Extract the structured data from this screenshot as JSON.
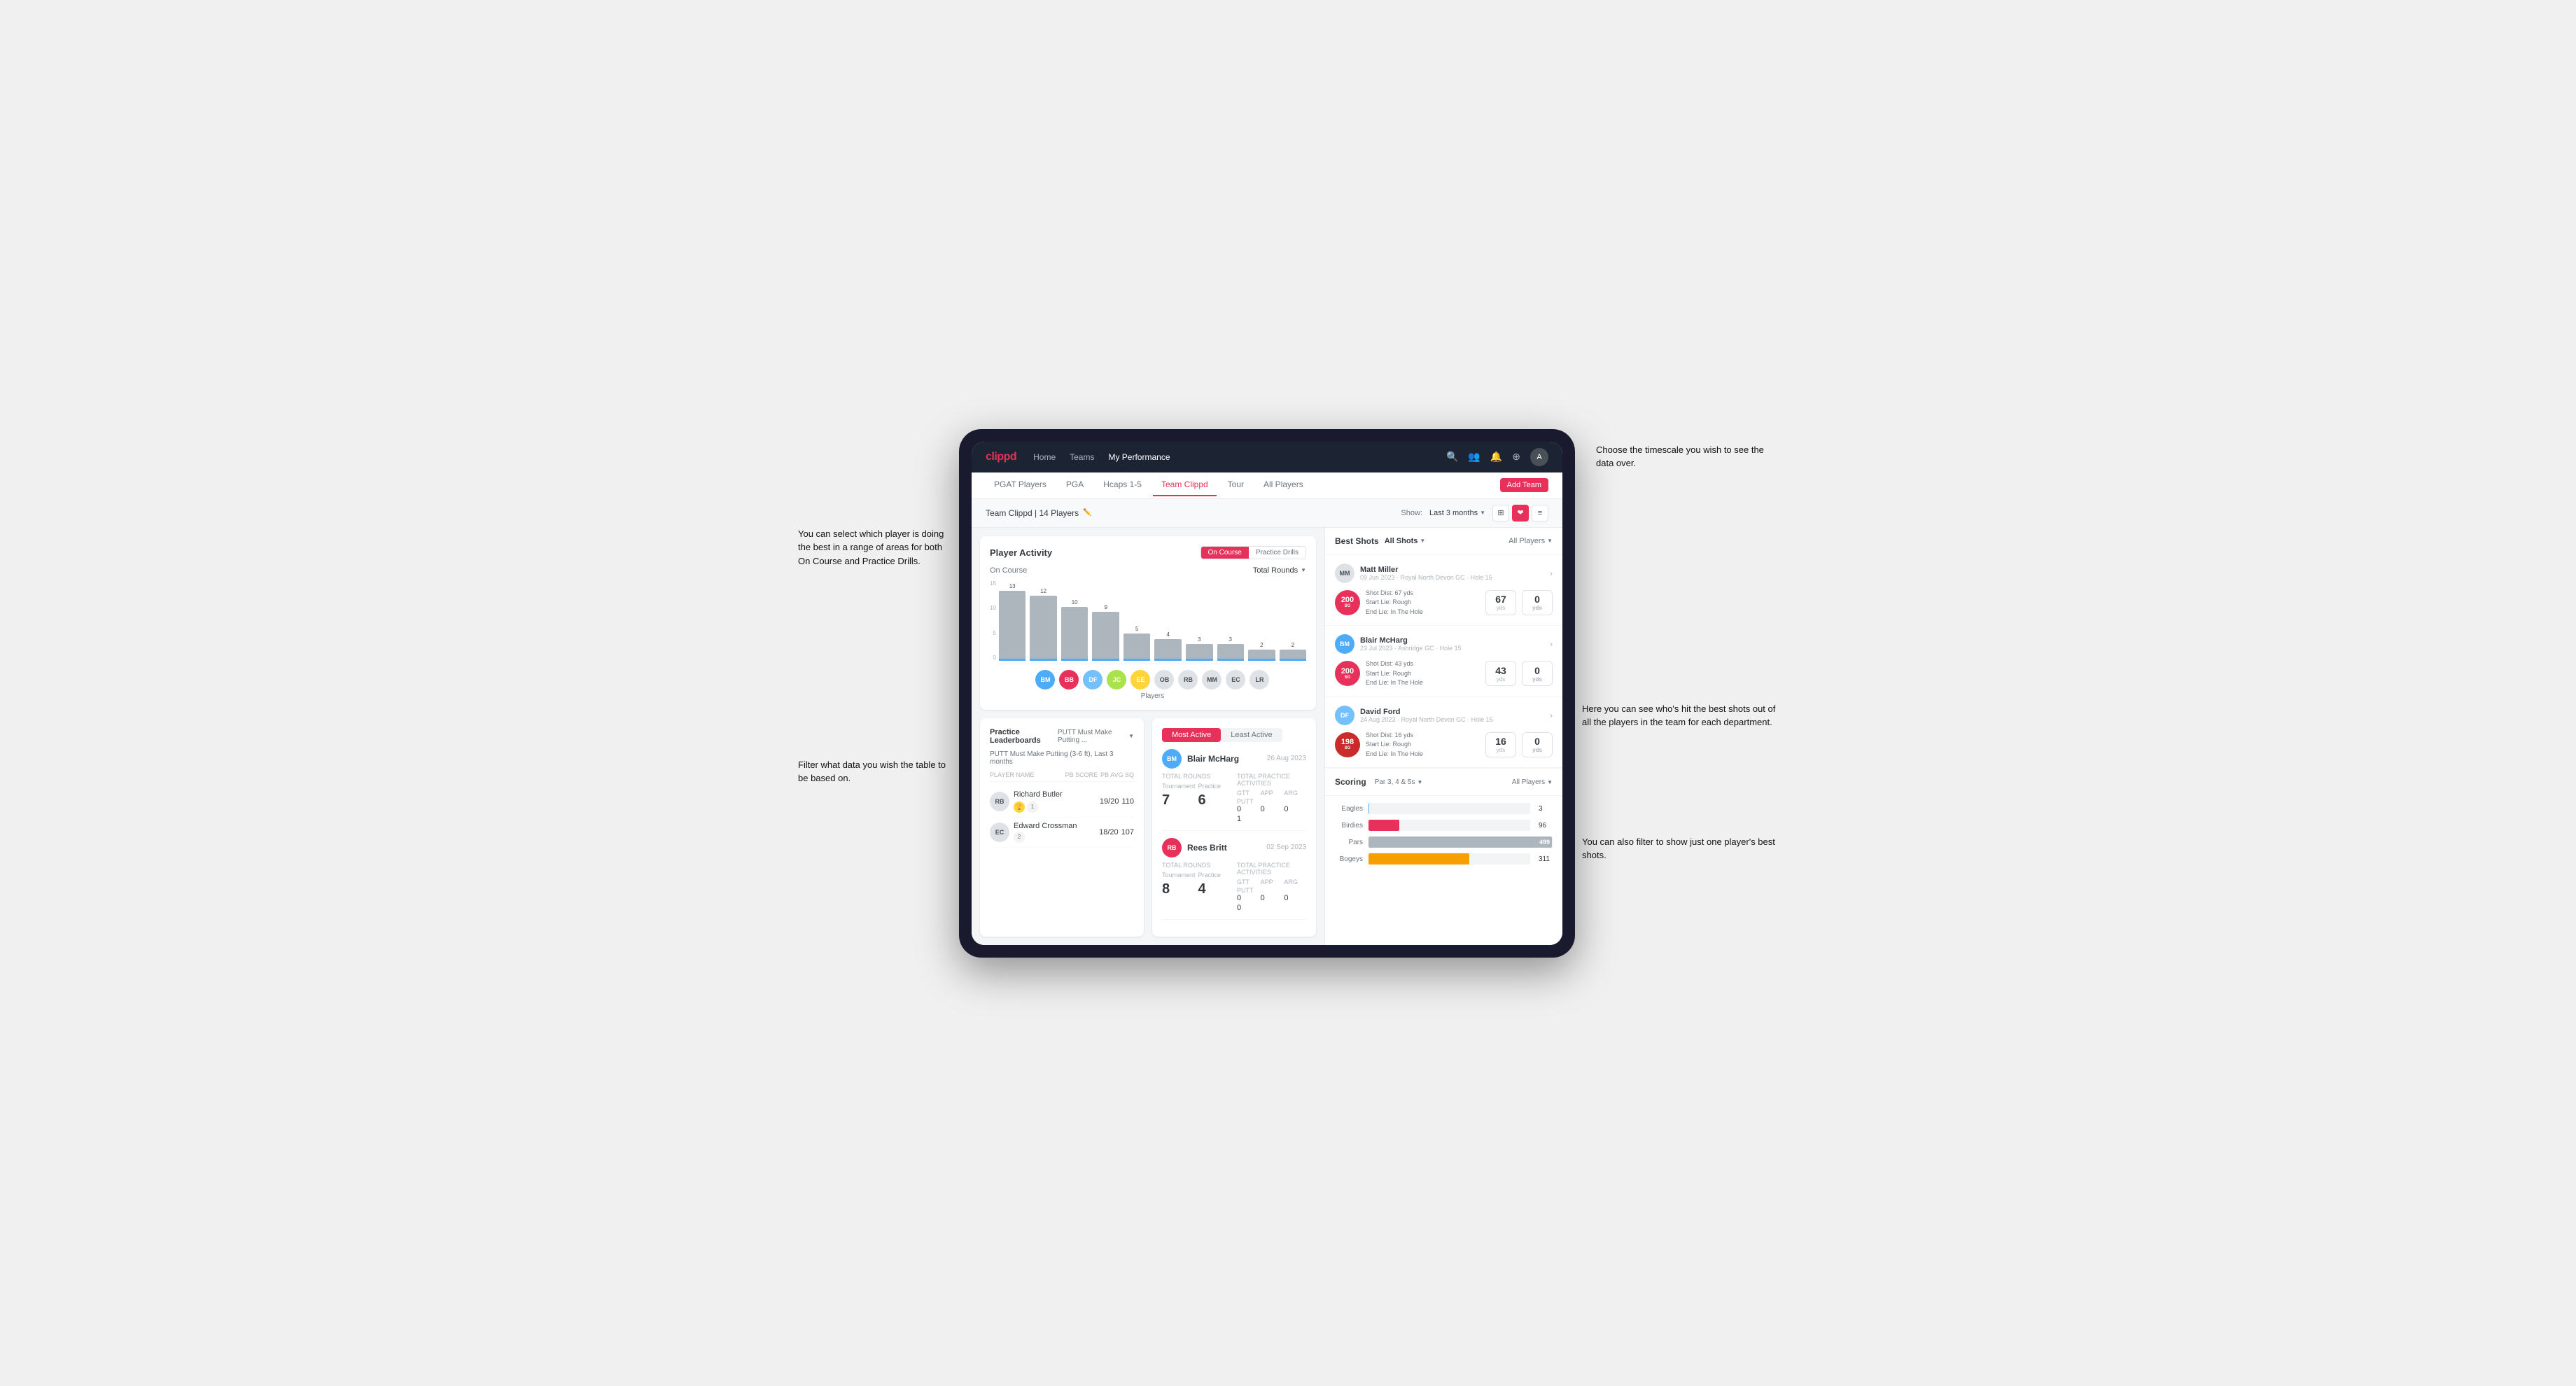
{
  "annotations": {
    "top_right": "Choose the timescale you wish to see the data over.",
    "left_top": "You can select which player is doing the best in a range of areas for both On Course and Practice Drills.",
    "left_bottom": "Filter what data you wish the table to be based on.",
    "right_middle": "Here you can see who's hit the best shots out of all the players in the team for each department.",
    "right_bottom": "You can also filter to show just one player's best shots."
  },
  "nav": {
    "logo": "clippd",
    "links": [
      "Home",
      "Teams",
      "My Performance"
    ],
    "active": "My Performance"
  },
  "subnav": {
    "links": [
      "PGAT Players",
      "PGA",
      "Hcaps 1-5",
      "Team Clippd",
      "Tour",
      "All Players"
    ],
    "active": "Team Clippd",
    "add_button": "Add Team"
  },
  "team_header": {
    "title": "Team Clippd | 14 Players",
    "show_label": "Show:",
    "show_value": "Last 3 months",
    "views": [
      "⊞",
      "❤",
      "≡"
    ]
  },
  "player_activity": {
    "title": "Player Activity",
    "toggle": [
      "On Course",
      "Practice Drills"
    ],
    "active_toggle": "On Course",
    "section_label": "On Course",
    "chart_dropdown": "Total Rounds",
    "y_labels": [
      "15",
      "10",
      "5",
      "0"
    ],
    "bars": [
      {
        "value": 13,
        "label": "B. McHarg",
        "height": 100
      },
      {
        "value": 12,
        "label": "B. Britt",
        "height": 92
      },
      {
        "value": 10,
        "label": "D. Ford",
        "height": 77
      },
      {
        "value": 9,
        "label": "J. Coles",
        "height": 69
      },
      {
        "value": 5,
        "label": "E. Ebert",
        "height": 38
      },
      {
        "value": 4,
        "label": "O. Billingham",
        "height": 31
      },
      {
        "value": 3,
        "label": "R. Butler",
        "height": 23
      },
      {
        "value": 3,
        "label": "M. Miller",
        "height": 23
      },
      {
        "value": 2,
        "label": "E. Crossman",
        "height": 15
      },
      {
        "value": 2,
        "label": "L. Robertson",
        "height": 15
      }
    ],
    "x_axis_label": "Players",
    "y_axis_label": "Total Rounds"
  },
  "leaderboard": {
    "title": "Practice Leaderboards",
    "dropdown": "PUTT Must Make Putting ...",
    "subtitle": "PUTT Must Make Putting (3-6 ft), Last 3 months",
    "cols": [
      "PLAYER NAME",
      "PB SCORE",
      "PB AVG SQ"
    ],
    "players": [
      {
        "name": "Richard Butler",
        "rank": 1,
        "pb_score": "19/20",
        "pb_avg": "110",
        "emoji": "🏆"
      },
      {
        "name": "Edward Crossman",
        "rank": 2,
        "pb_score": "18/20",
        "pb_avg": "107"
      }
    ]
  },
  "most_active": {
    "tabs": [
      "Most Active",
      "Least Active"
    ],
    "active_tab": "Most Active",
    "players": [
      {
        "name": "Blair McHarg",
        "date": "26 Aug 2023",
        "total_rounds_label": "Total Rounds",
        "tournament": "7",
        "practice": "6",
        "total_practice_label": "Total Practice Activities",
        "gtt": "0",
        "app": "0",
        "arg": "0",
        "putt": "1"
      },
      {
        "name": "Rees Britt",
        "date": "02 Sep 2023",
        "total_rounds_label": "Total Rounds",
        "tournament": "8",
        "practice": "4",
        "total_practice_label": "Total Practice Activities",
        "gtt": "0",
        "app": "0",
        "arg": "0",
        "putt": "0"
      }
    ]
  },
  "best_shots": {
    "title": "Best Shots",
    "tabs": [
      "All Shots",
      "All Players"
    ],
    "players": [
      {
        "name": "Matt Miller",
        "date": "09 Jun 2023",
        "club": "Royal North Devon GC",
        "hole": "Hole 15",
        "sg": "200",
        "sg_label": "SG",
        "shot_dist": "Shot Dist: 67 yds",
        "start_lie": "Start Lie: Rough",
        "end_lie": "End Lie: In The Hole",
        "yds": "67",
        "yds2": "0"
      },
      {
        "name": "Blair McHarg",
        "date": "23 Jul 2023",
        "club": "Ashridge GC",
        "hole": "Hole 15",
        "sg": "200",
        "sg_label": "SG",
        "shot_dist": "Shot Dist: 43 yds",
        "start_lie": "Start Lie: Rough",
        "end_lie": "End Lie: In The Hole",
        "yds": "43",
        "yds2": "0"
      },
      {
        "name": "David Ford",
        "date": "24 Aug 2023",
        "club": "Royal North Devon GC",
        "hole": "Hole 15",
        "sg": "198",
        "sg_label": "SG",
        "shot_dist": "Shot Dist: 16 yds",
        "start_lie": "Start Lie: Rough",
        "end_lie": "End Lie: In The Hole",
        "yds": "16",
        "yds2": "0"
      }
    ]
  },
  "scoring": {
    "title": "Scoring",
    "filter1": "Par 3, 4 & 5s",
    "filter2": "All Players",
    "rows": [
      {
        "label": "Eagles",
        "value": 3,
        "max": 500,
        "color": "#4dabf7"
      },
      {
        "label": "Birdies",
        "value": 96,
        "max": 500,
        "color": "#e8315a"
      },
      {
        "label": "Pars",
        "value": 499,
        "max": 500,
        "color": "#adb5bd"
      },
      {
        "label": "Bogeys",
        "value": 311,
        "max": 500,
        "color": "#f59f00"
      }
    ]
  },
  "colors": {
    "brand": "#e8315a",
    "accent_blue": "#4dabf7",
    "dark_nav": "#1c2333",
    "text_dark": "#343a40",
    "text_muted": "#6c757d",
    "border": "#dee2e6"
  }
}
